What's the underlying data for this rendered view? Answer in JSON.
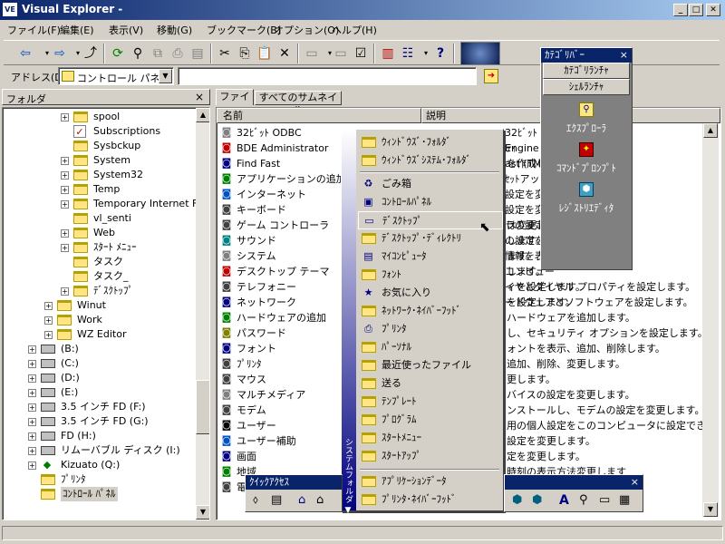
{
  "window": {
    "title": "Visual Explorer -",
    "icon_label": "VE",
    "min": "_",
    "max": "□",
    "close": "✕"
  },
  "menubar": [
    "ファイル(F)",
    "編集(E)",
    "表示(V)",
    "移動(G)",
    "ブックマーク(B)",
    "オプション(O)",
    "ヘルプ(H)"
  ],
  "address": {
    "label": "アドレス(D)",
    "value": "コントロール パネル",
    "input_value": ""
  },
  "folder_pane": {
    "title": "フォルダ",
    "close": "×"
  },
  "tree": [
    {
      "label": "spool"
    },
    {
      "label": "Subscriptions"
    },
    {
      "label": "Sysbckup"
    },
    {
      "label": "System"
    },
    {
      "label": "System32"
    },
    {
      "label": "Temp"
    },
    {
      "label": "Temporary Internet Fi"
    },
    {
      "label": "vl_senti"
    },
    {
      "label": "Web"
    },
    {
      "label": "ｽﾀｰﾄ ﾒﾆｭｰ"
    },
    {
      "label": "タスク"
    },
    {
      "label": "タスク_"
    },
    {
      "label": "ﾃﾞｽｸﾄｯﾌﾟ"
    },
    {
      "label": "Winut"
    },
    {
      "label": "Work"
    },
    {
      "label": "WZ Editor"
    },
    {
      "label": "(B:)"
    },
    {
      "label": "(C:)"
    },
    {
      "label": "(D:)"
    },
    {
      "label": "(E:)"
    },
    {
      "label": "3.5 インチ FD (F:)"
    },
    {
      "label": "3.5 インチ FD (G:)"
    },
    {
      "label": "FD (H:)"
    },
    {
      "label": "リムーバブル ディスク (I:)"
    },
    {
      "label": "Kizuato (Q:)"
    },
    {
      "label": "ﾌﾟﾘﾝﾀ"
    },
    {
      "label": "ｺﾝﾄﾛｰﾙ ﾊﾟﾈﾙ"
    }
  ],
  "tabs": [
    "ファイル",
    "すべてのサムネイル"
  ],
  "columns": [
    "名前",
    "説明"
  ],
  "files": [
    {
      "name": "32ﾋﾞｯﾄ ODBC",
      "desc": ""
    },
    {
      "name": "BDE Administrator",
      "desc": "ﾃｨ"
    },
    {
      "name": "Find Fast",
      "desc": "を作成します。"
    },
    {
      "name": "アプリケーションの追加",
      "desc": ""
    },
    {
      "name": "インターネット",
      "desc": ""
    },
    {
      "name": "キーボード",
      "desc": ""
    },
    {
      "name": "ゲーム コントローラ",
      "desc": "は変更します"
    },
    {
      "name": "サウンド",
      "desc": "します。"
    },
    {
      "name": "システム",
      "desc": "ます。"
    },
    {
      "name": "デスクトップ テーマ",
      "desc": "します。"
    },
    {
      "name": "テレフォニー",
      "desc": "ィを設定します。"
    },
    {
      "name": "ネットワーク",
      "desc": "を設定します。"
    },
    {
      "name": "ハードウェアの追加",
      "desc": "ハードウェアを追加します。"
    },
    {
      "name": "パスワード",
      "desc": "し、セキュリティ オプションを設定します。"
    },
    {
      "name": "フォント",
      "desc": "ォントを表示、追加、削除します。"
    },
    {
      "name": "ﾌﾟﾘﾝﾀ",
      "desc": "追加、削除、変更します。"
    },
    {
      "name": "マウス",
      "desc": "更します。"
    },
    {
      "name": "マルチメディア",
      "desc": "バイスの設定を変更します。"
    },
    {
      "name": "モデム",
      "desc": "ンストールし、モデムの設定を変更します。"
    },
    {
      "name": "ユーザー",
      "desc": "用の個人設定をこのコンピュータに設定でき"
    },
    {
      "name": "ユーザー補助",
      "desc": "設定を変更します。"
    },
    {
      "name": "画面",
      "desc": "定を変更します。"
    },
    {
      "name": "地域",
      "desc": "時刻の表示方法変更します"
    },
    {
      "name": "電",
      "desc": ""
    }
  ],
  "partial_desc": [
    {
      "text": "32ﾋﾞｯﾄ ODBC ﾃﾞｰﾀ ｿｰｽと"
    },
    {
      "text": "Engine"
    },
    {
      "text": "ast (TM"
    },
    {
      "text": "ｾｯﾄアップ"
    },
    {
      "text": "設定を変"
    },
    {
      "text": "設定を変"
    },
    {
      "text": "ラの設定"
    },
    {
      "text": "の設定を"
    },
    {
      "text": "情報を表"
    },
    {
      "text": "コンピュー"
    },
    {
      "text": "イヤとダイヤル プロパティを設定します。"
    },
    {
      "text": "ードウェアとソフトウェアを設定します。"
    }
  ],
  "popup_menu": {
    "side_label": "システムフォルダ ▼",
    "items": [
      {
        "label": "ｳｨﾝﾄﾞｳｽﾞ･ﾌｫﾙﾀﾞ",
        "icon": "folder-icon"
      },
      {
        "label": "ｳｨﾝﾄﾞｳｽﾞｼｽﾃﾑ･ﾌｫﾙﾀﾞ",
        "icon": "folder-icon"
      },
      {
        "label": "ごみ箱",
        "icon": "recycle-bin-icon"
      },
      {
        "label": "ｺﾝﾄﾛｰﾙﾊﾟﾈﾙ",
        "icon": "control-panel-icon"
      },
      {
        "label": "ﾃﾞｽｸﾄｯﾌﾟ",
        "icon": "desktop-icon"
      },
      {
        "label": "ﾃﾞｽｸﾄｯﾌﾟ･ﾃﾞｨﾚｸﾄﾘ",
        "icon": "folder-icon"
      },
      {
        "label": "ﾏｲｺﾝﾋﾟｭｰﾀ",
        "icon": "my-computer-icon"
      },
      {
        "label": "ﾌｫﾝﾄ",
        "icon": "folder-icon"
      },
      {
        "label": "お気に入り",
        "icon": "favorites-icon"
      },
      {
        "label": "ﾈｯﾄﾜｰｸ･ﾈｲﾊﾞｰﾌｯﾄﾞ",
        "icon": "folder-icon"
      },
      {
        "label": "ﾌﾟﾘﾝﾀ",
        "icon": "printer-icon"
      },
      {
        "label": "ﾊﾟｰｿﾅﾙ",
        "icon": "folder-icon"
      },
      {
        "label": "最近使ったファイル",
        "icon": "folder-icon"
      },
      {
        "label": "送る",
        "icon": "folder-icon"
      },
      {
        "label": "ﾃﾝﾌﾟﾚｰﾄ",
        "icon": "folder-icon"
      },
      {
        "label": "ﾌﾟﾛｸﾞﾗﾑ",
        "icon": "folder-icon"
      },
      {
        "label": "ｽﾀｰﾄﾒﾆｭｰ",
        "icon": "folder-icon"
      },
      {
        "label": "ｽﾀｰﾄｱｯﾌﾟ",
        "icon": "folder-icon"
      },
      {
        "label": "ｱﾌﾟﾘｹｰｼｮﾝﾃﾞｰﾀ",
        "icon": "folder-icon"
      },
      {
        "label": "ﾌﾟﾘﾝﾀ･ﾈｲﾊﾞｰﾌｯﾄﾞ",
        "icon": "folder-icon"
      }
    ]
  },
  "category_bar": {
    "title": "ｶﾃｺﾞﾘﾊﾞｰ",
    "close": "×",
    "buttons": [
      "ｶﾃｺﾞﾘﾗﾝﾁｬ",
      "ｼｪﾙﾗﾝﾁｬ"
    ],
    "launchers": [
      {
        "label": "ｴｸｽﾌﾟﾛｰﾗ",
        "icon": "explorer-icon"
      },
      {
        "label": "ｺﾏﾝﾄﾞﾌﾟﾛﾝﾌﾟﾄ",
        "icon": "command-prompt-icon"
      },
      {
        "label": "ﾚｼﾞｽﾄﾘｴﾃﾞｨﾀ",
        "icon": "registry-editor-icon"
      }
    ]
  },
  "quick_access": {
    "title": "ｸｲｯｸｱｸｾｽ",
    "close": "×"
  },
  "colors": {
    "title_start": "#0a246a",
    "title_end": "#a6caf0",
    "face": "#d4d0c8",
    "folder": "#ffe680"
  }
}
